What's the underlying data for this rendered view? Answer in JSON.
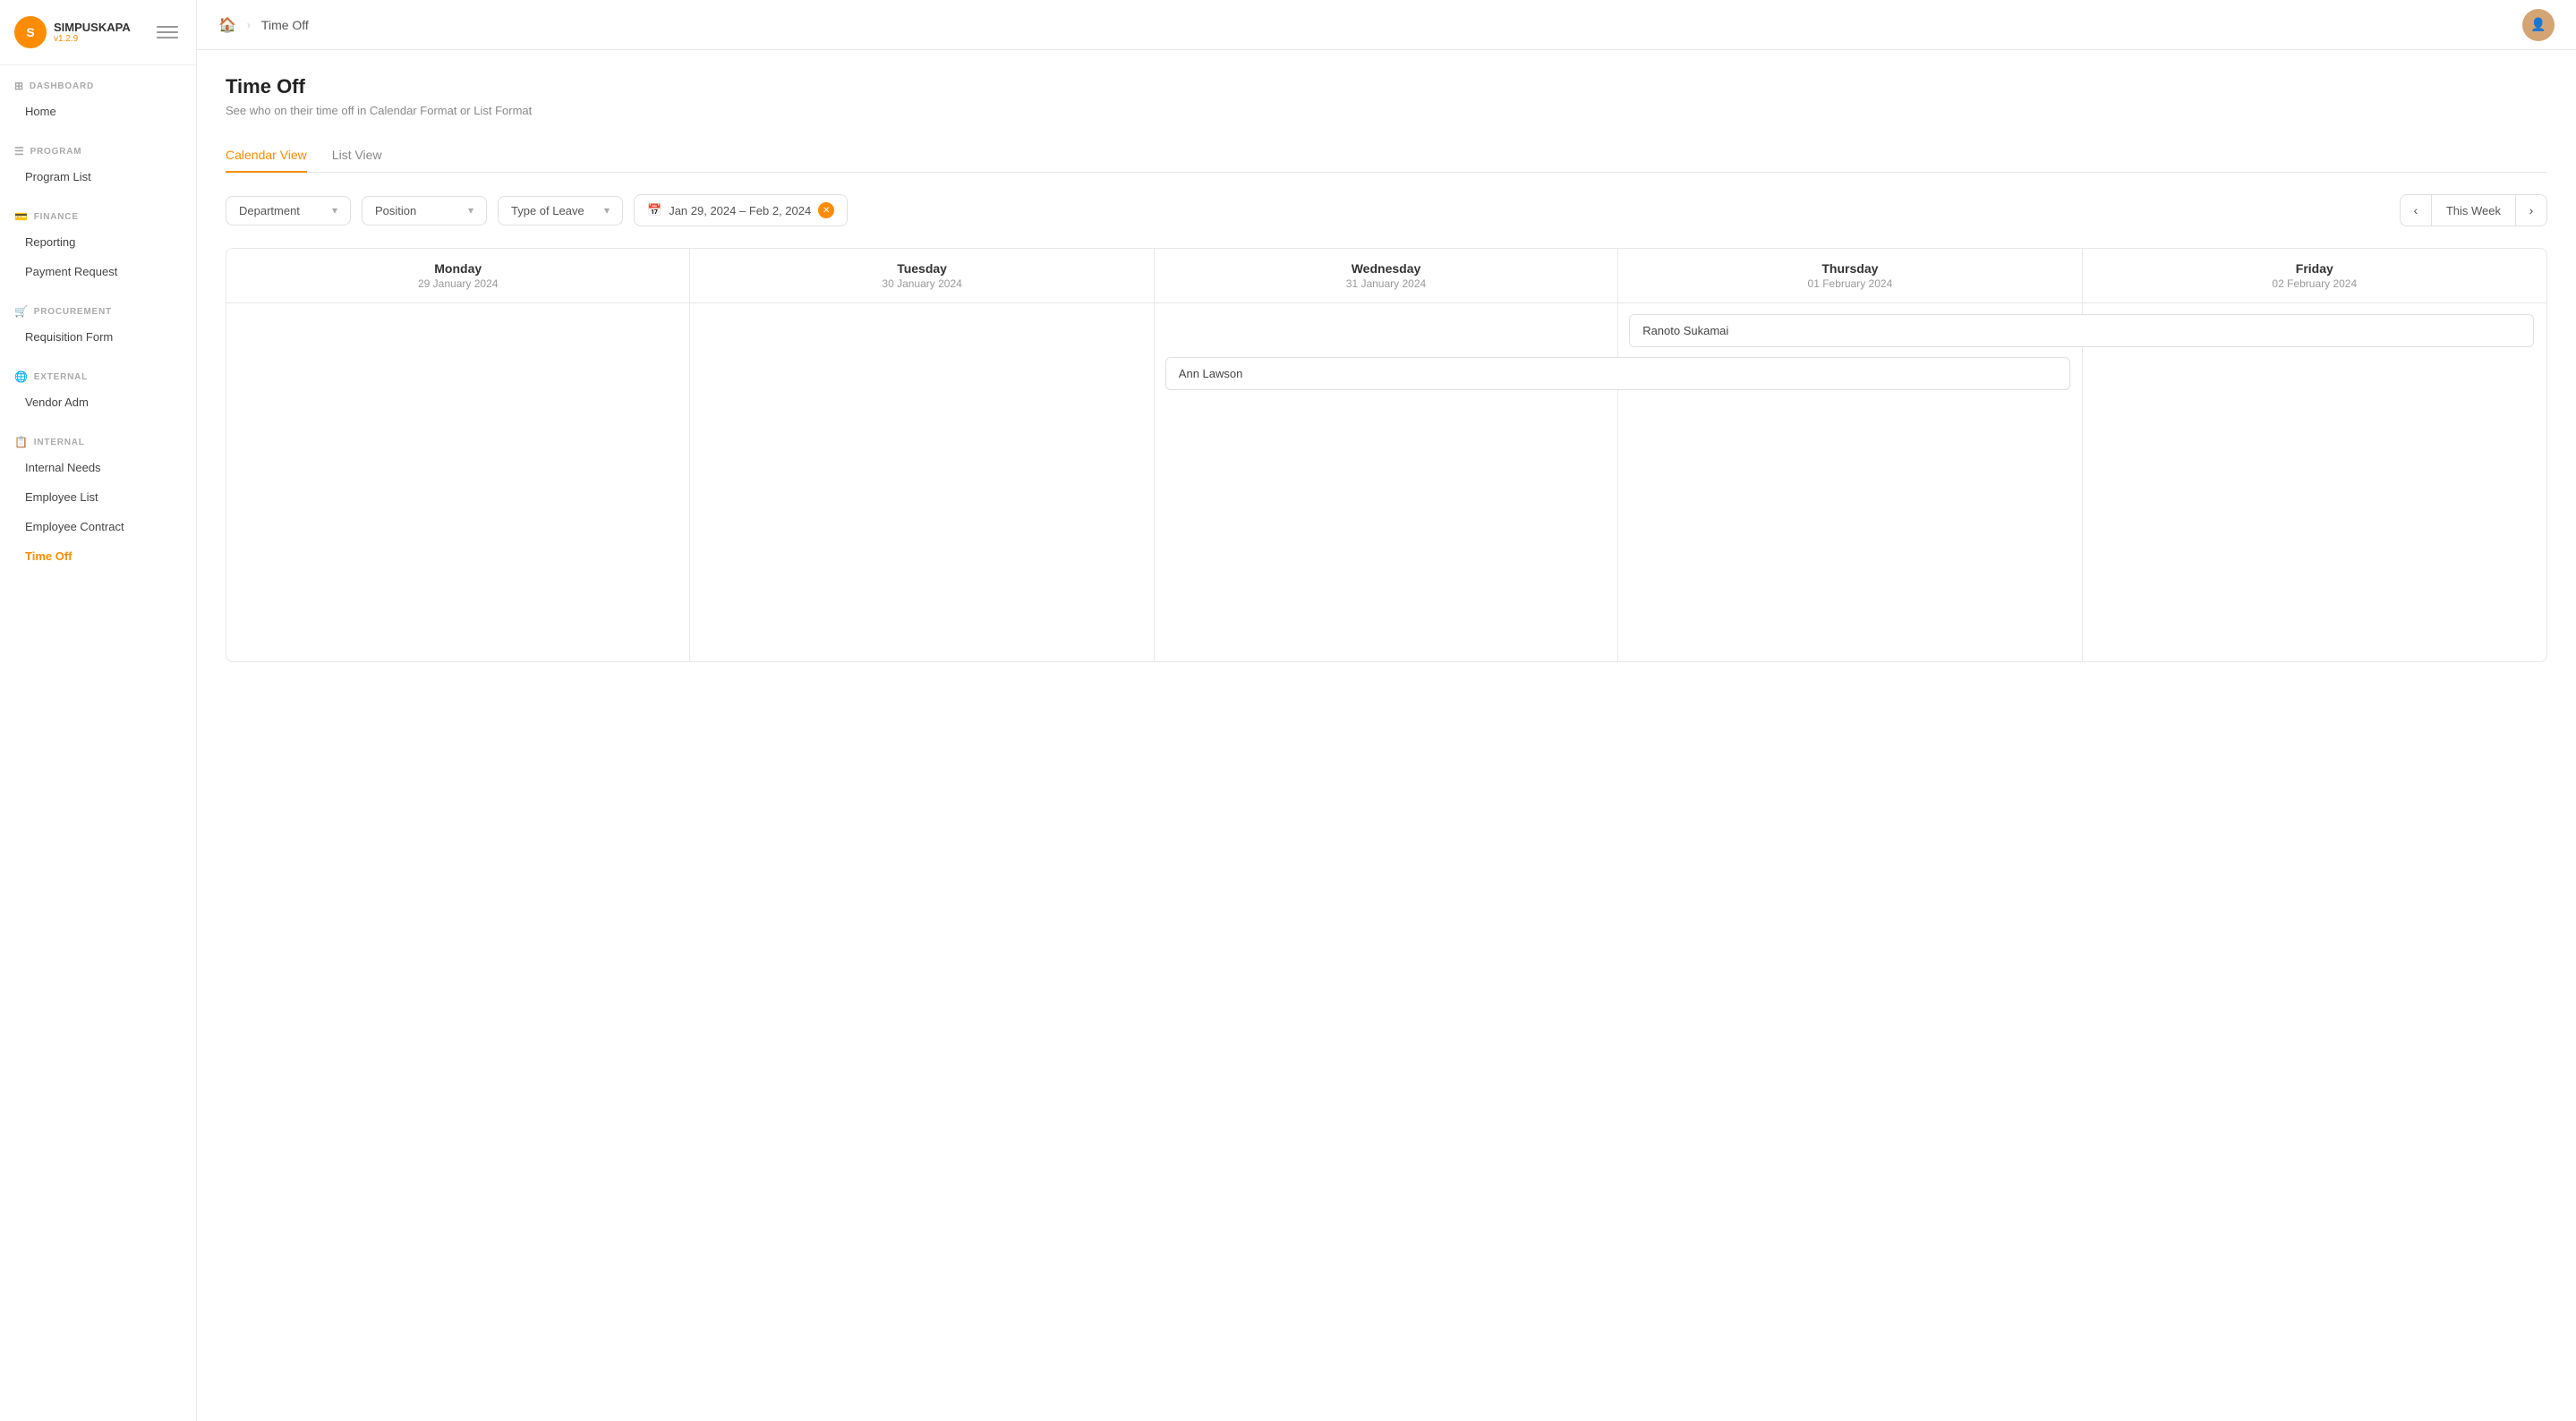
{
  "app": {
    "name": "SIMPUSKAPA",
    "version": "v1.2.9"
  },
  "topbar": {
    "home_icon": "🏠",
    "separator": ">",
    "current_page": "Time Off"
  },
  "sidebar": {
    "sections": [
      {
        "label": "DASHBOARD",
        "icon": "⊞",
        "items": [
          {
            "id": "home",
            "label": "Home",
            "active": false
          }
        ]
      },
      {
        "label": "PROGRAM",
        "icon": "☰",
        "items": [
          {
            "id": "program-list",
            "label": "Program List",
            "active": false
          }
        ]
      },
      {
        "label": "FINANCE",
        "icon": "💳",
        "items": [
          {
            "id": "reporting",
            "label": "Reporting",
            "active": false
          },
          {
            "id": "payment-request",
            "label": "Payment Request",
            "active": false
          }
        ]
      },
      {
        "label": "PROCUREMENT",
        "icon": "🛒",
        "items": [
          {
            "id": "requisition-form",
            "label": "Requisition Form",
            "active": false
          }
        ]
      },
      {
        "label": "EXTERNAL",
        "icon": "🌐",
        "items": [
          {
            "id": "vendor-adm",
            "label": "Vendor Adm",
            "active": false
          }
        ]
      },
      {
        "label": "INTERNAL",
        "icon": "📋",
        "items": [
          {
            "id": "internal-needs",
            "label": "Internal Needs",
            "active": false
          },
          {
            "id": "employee-list",
            "label": "Employee List",
            "active": false
          },
          {
            "id": "employee-contract",
            "label": "Employee Contract",
            "active": false
          },
          {
            "id": "time-off",
            "label": "Time Off",
            "active": true
          }
        ]
      }
    ]
  },
  "page": {
    "title": "Time Off",
    "subtitle": "See who on their time off in Calendar Format or List Format"
  },
  "tabs": [
    {
      "id": "calendar-view",
      "label": "Calendar View",
      "active": true
    },
    {
      "id": "list-view",
      "label": "List View",
      "active": false
    }
  ],
  "filters": {
    "department": {
      "label": "Department",
      "placeholder": "Department"
    },
    "position": {
      "label": "Position",
      "placeholder": "Position"
    },
    "type_of_leave": {
      "label": "Type of Leave",
      "placeholder": "Type of Leave"
    },
    "date_range": {
      "value": "Jan 29, 2024 – Feb 2, 2024",
      "has_clear": true
    }
  },
  "week_nav": {
    "label": "This Week",
    "prev_label": "‹",
    "next_label": "›"
  },
  "calendar": {
    "columns": [
      {
        "day": "Monday",
        "date": "29 January 2024"
      },
      {
        "day": "Tuesday",
        "date": "30 January 2024"
      },
      {
        "day": "Wednesday",
        "date": "31 January 2024"
      },
      {
        "day": "Thursday",
        "date": "01 February 2024"
      },
      {
        "day": "Friday",
        "date": "02 February 2024"
      }
    ],
    "events": [
      {
        "column": 2,
        "name": "Ann Lawson",
        "span": 2
      },
      {
        "column": 3,
        "name": "Ranoto Sukamai",
        "span": 2
      }
    ]
  }
}
